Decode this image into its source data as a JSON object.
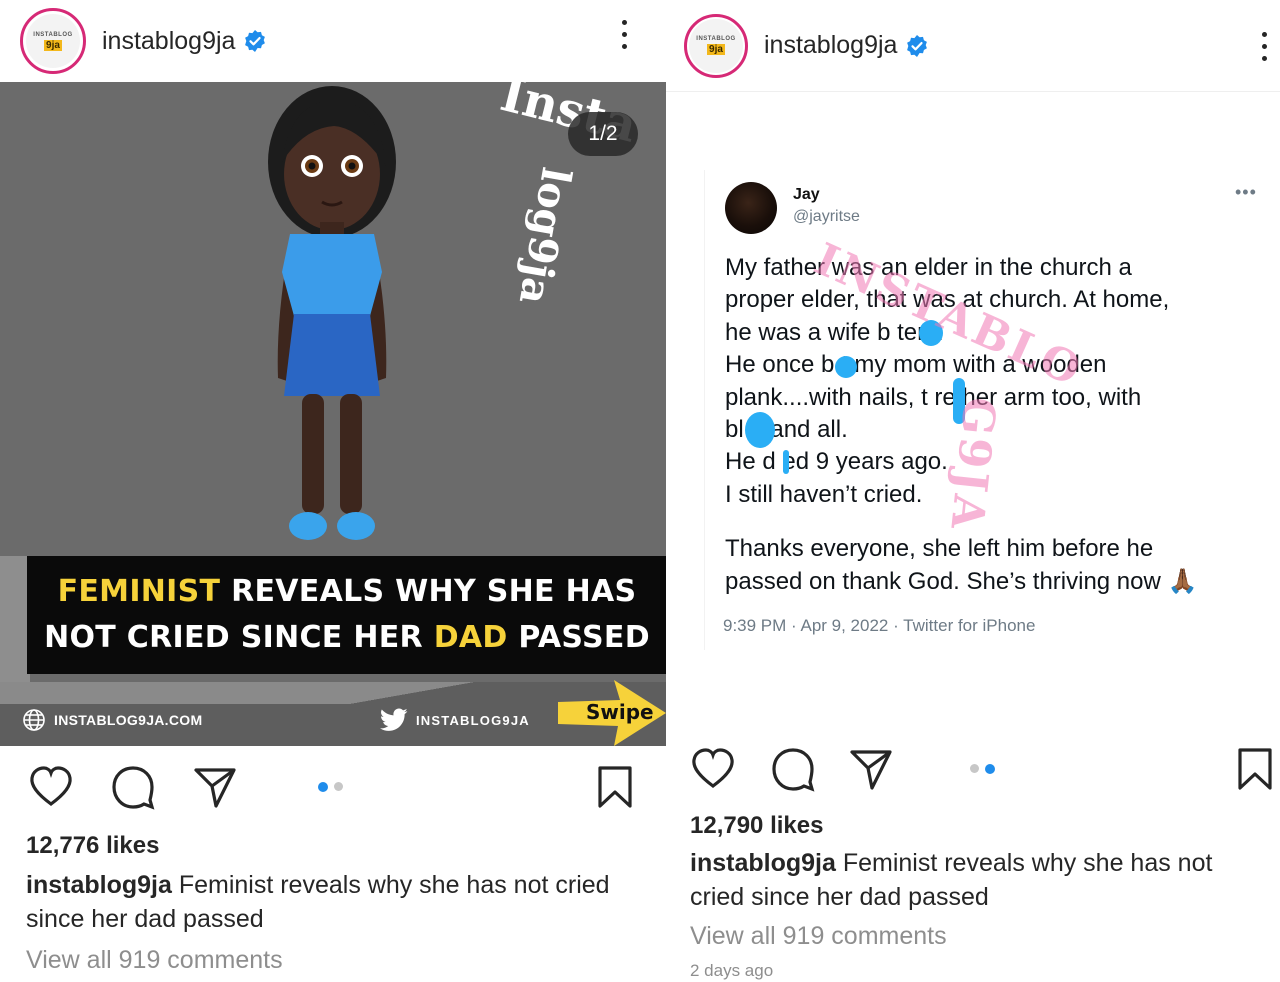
{
  "posts": [
    {
      "username": "instablog9ja",
      "avatar": {
        "top": "INSTABLOG",
        "logo": "9ja"
      },
      "media": {
        "counter": "1/2",
        "watermark_a": "Insta",
        "watermark_b": "log9ja",
        "headline_line1_yellow": "FEMINIST",
        "headline_line1_rest": " REVEALS WHY SHE HAS",
        "headline_line2_start": "NOT CRIED SINCE HER ",
        "headline_line2_yellow": "DAD",
        "headline_line2_end": " PASSED",
        "site": "INSTABLOG9JA.COM",
        "twitter": "INSTABLOG9JA",
        "swipe": "Swipe"
      },
      "likes": "12,776 likes",
      "caption_user": "instablog9ja",
      "caption_text": " Feminist reveals why she has not cried since her dad passed",
      "comments": "View all 919 comments"
    },
    {
      "username": "instablog9ja",
      "avatar": {
        "top": "INSTABLOG",
        "logo": "9ja"
      },
      "tweet": {
        "name": "Jay",
        "handle": "@jayritse",
        "more": "•••",
        "lines": [
          "My father was an elder in the church a",
          "proper elder, that was at church. At home,",
          "he was a wife b   ter...",
          "He once b   t my mom with a wooden",
          "plank....with nails, t   re her arm too, with",
          "bl   d and all.",
          "He d ed 9 years ago.",
          "I still haven’t cried."
        ],
        "lines2": [
          "Thanks everyone, she left him before he",
          "passed on thank God. She’s thriving now 🙏🏾"
        ],
        "meta": "9:39 PM · Apr 9, 2022 · Twitter for iPhone",
        "watermark_a": "INSTABLO",
        "watermark_b": "G9JA"
      },
      "likes": "12,790 likes",
      "caption_user": "instablog9ja",
      "caption_text": " Feminist reveals why she has not cried since her dad passed",
      "comments": "View all 919 comments",
      "time_ago": "2 days ago"
    }
  ],
  "colors": {
    "verified": "#1f8ceb",
    "accent_yellow": "#f6d23a",
    "active_dot": "#1f8ceb"
  },
  "icons": [
    "verified-icon",
    "more-icon",
    "heart-icon",
    "comment-icon",
    "share-icon",
    "bookmark-icon",
    "globe-icon",
    "twitter-icon",
    "swipe-arrow-icon"
  ]
}
